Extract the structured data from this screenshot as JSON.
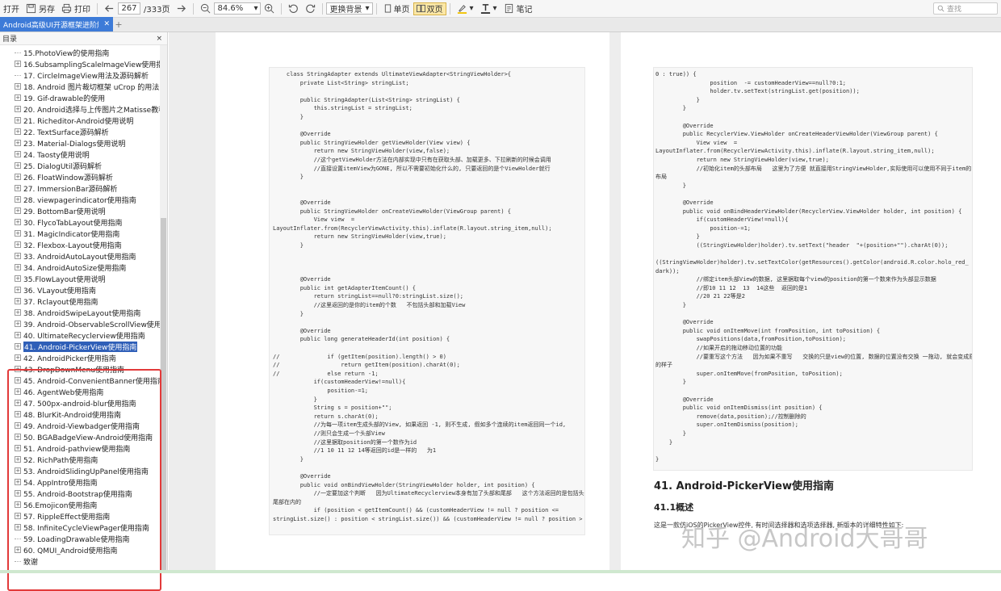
{
  "toolbar": {
    "open": "打开",
    "save_as": "另存",
    "print": "打印",
    "page_current": "267",
    "page_total": "/333页",
    "zoom": "84.6%",
    "change_bg": "更换背景",
    "single_page": "单页",
    "double_page": "双页",
    "notes": "笔记",
    "search_placeholder": "查找"
  },
  "tab": {
    "title": "Android高级UI开源框架进阶解"
  },
  "sidebar": {
    "title": "目录",
    "items": [
      {
        "label": "15.PhotoView的使用指南",
        "expandable": false
      },
      {
        "label": "16.SubsamplingScaleImageView使用指南",
        "expandable": true
      },
      {
        "label": "17. CircleImageView用法及源码解析",
        "expandable": false
      },
      {
        "label": "18. Android 图片裁切框架 uCrop 的用法",
        "expandable": true
      },
      {
        "label": "19. Gif-drawable的使用",
        "expandable": true
      },
      {
        "label": "20. Android选择与上传图片之Matisse教程",
        "expandable": true
      },
      {
        "label": "21. Richeditor-Android使用说明",
        "expandable": true
      },
      {
        "label": "22. TextSurface源码解析",
        "expandable": true
      },
      {
        "label": "23. Material-Dialogs使用说明",
        "expandable": true
      },
      {
        "label": "24. Taosty使用说明",
        "expandable": true
      },
      {
        "label": "25. DialogUtil源码解析",
        "expandable": true
      },
      {
        "label": "26. FloatWindow源码解析",
        "expandable": true
      },
      {
        "label": "27. ImmersionBar源码解析",
        "expandable": true
      },
      {
        "label": "28. viewpagerindicator使用指南",
        "expandable": true
      },
      {
        "label": "29. BottomBar使用说明",
        "expandable": true
      },
      {
        "label": "30. FlycoTabLayout使用指南",
        "expandable": true
      },
      {
        "label": "31. MagicIndicator使用指南",
        "expandable": true
      },
      {
        "label": "32. Flexbox-Layout使用指南",
        "expandable": true
      },
      {
        "label": "33. AndroidAutoLayout使用指南",
        "expandable": true
      },
      {
        "label": "34. AndroidAutoSize使用指南",
        "expandable": true
      },
      {
        "label": "35.FlowLayout使用说明",
        "expandable": true
      },
      {
        "label": "36. VLayout使用指南",
        "expandable": true
      },
      {
        "label": "37. Rclayout使用指南",
        "expandable": true
      },
      {
        "label": "38. AndroidSwipeLayout使用指南",
        "expandable": true
      },
      {
        "label": "39. Android-ObservableScrollView使用指南",
        "expandable": true
      },
      {
        "label": "40. UltimateRecyclerview使用指南",
        "expandable": true
      },
      {
        "label": "41. Android-PickerView使用指南",
        "expandable": true,
        "selected": true
      },
      {
        "label": "42. AndroidPicker使用指南",
        "expandable": true
      },
      {
        "label": "43. DropDownMenu使用指南",
        "expandable": true
      },
      {
        "label": "45. Android-ConvenientBanner使用指南",
        "expandable": true
      },
      {
        "label": "46. AgentWeb使用指南",
        "expandable": true
      },
      {
        "label": "47. 500px-android-blur使用指南",
        "expandable": true
      },
      {
        "label": "48. BlurKit-Android使用指南",
        "expandable": true
      },
      {
        "label": "49. Android-Viewbadger使用指南",
        "expandable": true
      },
      {
        "label": "50. BGABadgeView-Android使用指南",
        "expandable": true
      },
      {
        "label": "51. Android-pathview使用指南",
        "expandable": true
      },
      {
        "label": "52. RichPath使用指南",
        "expandable": true
      },
      {
        "label": "53. AndroidSlidingUpPanel使用指南",
        "expandable": true
      },
      {
        "label": "54. AppIntro使用指南",
        "expandable": true
      },
      {
        "label": "55. Android-Bootstrap使用指南",
        "expandable": true
      },
      {
        "label": "56.Emojicon使用指南",
        "expandable": true
      },
      {
        "label": "57. RippleEffect使用指南",
        "expandable": true
      },
      {
        "label": "58. InfiniteCycleViewPager使用指南",
        "expandable": true
      },
      {
        "label": "59. LoadingDrawable使用指南",
        "expandable": false
      },
      {
        "label": "60. QMUI_Android使用指南",
        "expandable": true
      },
      {
        "label": "致谢",
        "expandable": false
      }
    ]
  },
  "left_page": {
    "code": "    class StringAdapter extends UltimateViewAdapter<StringViewHolder>{\n        private List<String> stringList;\n\n        public StringAdapter(List<String> stringList) {\n            this.stringList = stringList;\n        }\n\n        @Override\n        public StringViewHolder getViewHolder(View view) {\n            return new StringViewHolder(view,false);\n            //这个getViewHolder方法在内部实现中只有在获取头部、加载更多、下拉刷新的时候会调用\n            //直接设置itemView为GONE, 所以不需要初始化什么的, 只要返回的是个ViewHolder就行\n        }\n\n\n        @Override\n        public StringViewHolder onCreateViewHolder(ViewGroup parent) {\n            View view  =\nLayoutInflater.from(RecyclerViewActivity.this).inflate(R.layout.string_item,null);\n            return new StringViewHolder(view,true);\n        }\n\n\n\n        @Override\n        public int getAdapterItemCount() {\n            return stringList==null?0:stringList.size();\n            //这里返回的是你的item的个数   不包括头部和加载View\n        }\n\n        @Override\n        public long generateHeaderId(int position) {\n\n//              if (getItem(position).length() > 0)\n//                  return getItem(position).charAt(0);\n//              else return -1;\n            if(customHeaderView!=null){\n                position-=1;\n            }\n            String s = position+\"\";\n            return s.charAt(0);\n            //为每一项item生成头部的View, 如果返回 -1, 则不生成, 假如多个连续的item返回同一个id,\n            //则只会生成一个头部View\n            //这里据取position的第一个数作为id\n            //1 10 11 12 14等返回的id是一样的   为1\n        }\n\n        @Override\n        public void onBindViewHolder(StringViewHolder holder, int position) {\n            //一定要加这个判断   因为UltimateRecyclerview本身有加了头部和尾部   这个方法返回的是包括头部和\n尾部在内的\n            if (position < getItemCount() && (customHeaderView != null ? position <=\nstringList.size() : position < stringList.size()) && (customHeaderView != null ? position >"
  },
  "right_page": {
    "code": "0 : true)) {\n                position  -= customHeaderView==null?0:1;\n                holder.tv.setText(stringList.get(position));\n            }\n        }\n\n        @Override\n        public RecyclerView.ViewHolder onCreateHeaderViewHolder(ViewGroup parent) {\n            View view  =\nLayoutInflater.from(RecyclerViewActivity.this).inflate(R.layout.string_item,null);\n            return new StringViewHolder(view,true);\n            //初始化item的头部布局   这里为了方便 就直接用StringViewHolder,实际使用可以使用不同于item的\n布局\n        }\n\n        @Override\n        public void onBindHeaderViewHolder(RecyclerView.ViewHolder holder, int position) {\n            if(customHeaderView!=null){\n                position-=1;\n            }\n            ((StringViewHolder)holder).tv.setText(\"header  \"+(position+\"\").charAt(0));\n\n((StringViewHolder)holder).tv.setTextColor(getResources().getColor(android.R.color.holo_red_\ndark));\n            //绑定item头部View的数据, 这里据取每个view的position的第一个数来作为头部显示数据\n            //即10 11 12  13  14这些  返回的是1\n            //20 21 22等是2\n        }\n\n        @Override\n        public void onItemMove(int fromPosition, int toPosition) {\n            swapPositions(data,fromPosition,toPosition);\n            //如果开启的拖动移动位置的功能\n            //要重写这个方法   因为如果不重写   交换的只是view的位置, 数据的位置没有交换 一拖动, 就会变成原来\n的样子\n            super.onItemMove(fromPosition, toPosition);\n        }\n\n        @Override\n        public void onItemDismiss(int position) {\n            remove(data,position);//控制删除的\n            super.onItemDismiss(position);\n        }\n    }\n\n}",
    "heading": "41. Android-PickerView使用指南",
    "subheading": "41.1概述",
    "paragraph": "这是一款仿iOS的PickerView控件, 有时间选择器和选项选择器, 新版本的详细特性如下:",
    "watermark": "知乎 @Android大哥哥"
  }
}
